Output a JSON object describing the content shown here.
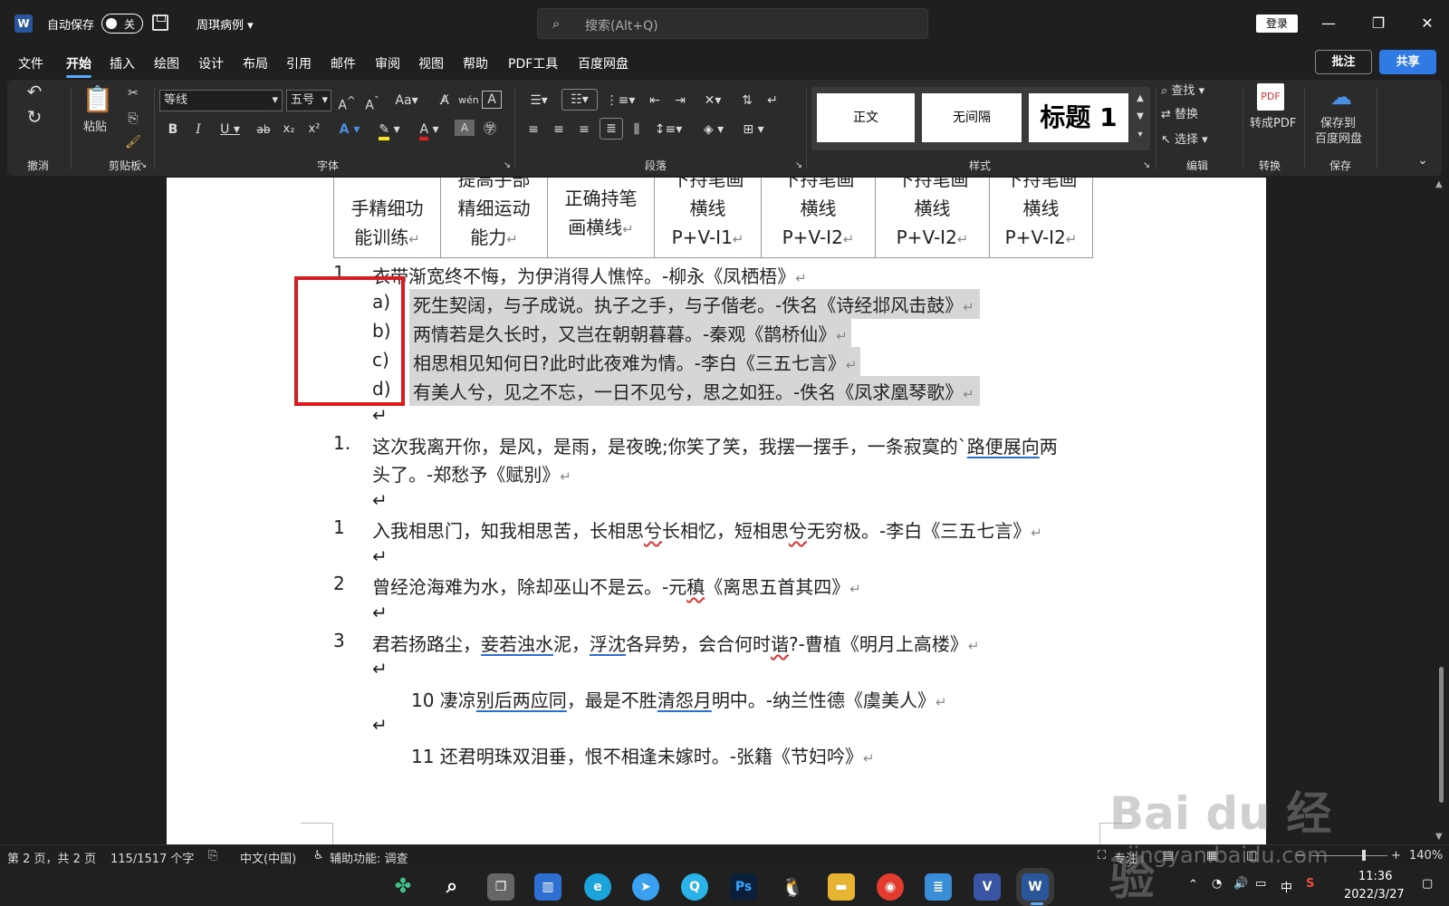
{
  "app": {
    "autosave_label": "自动保存",
    "autosave_state": "关",
    "doc_title": "周琪病例 ▾",
    "search_placeholder": "搜索(Alt+Q)",
    "login_label": "登录"
  },
  "tabs": [
    "文件",
    "开始",
    "插入",
    "绘图",
    "设计",
    "布局",
    "引用",
    "邮件",
    "审阅",
    "视图",
    "帮助",
    "PDF工具",
    "百度网盘"
  ],
  "active_tab": "开始",
  "tab_actions": {
    "comment": "批注",
    "share": "共享"
  },
  "ribbon": {
    "undo_group": "撤消",
    "clipboard": {
      "paste": "粘贴",
      "group": "剪贴板"
    },
    "font": {
      "name": "等线",
      "size": "五号",
      "group": "字体"
    },
    "paragraph_group": "段落",
    "styles": {
      "items": [
        "正文",
        "无间隔",
        "标题 1"
      ],
      "group": "样式"
    },
    "editing": {
      "find": "查找",
      "replace": "替换",
      "select": "选择",
      "group": "编辑"
    },
    "convert": {
      "label": "转成PDF",
      "group": "转换"
    },
    "save": {
      "label_line1": "保存到",
      "label_line2": "百度网盘",
      "group": "保存"
    }
  },
  "table_header": [
    [
      "手精细功",
      "能训练"
    ],
    [
      "提高手部",
      "精细运动",
      "能力"
    ],
    [
      "正确持笔",
      "画横线"
    ],
    [
      "下持笔画",
      "横线",
      "P+V-I1"
    ],
    [
      "下持笔画",
      "横线",
      "P+V-I2"
    ],
    [
      "下持笔画",
      "横线",
      "P+V-I2"
    ],
    [
      "下持笔画",
      "横线",
      "P+V-I2"
    ]
  ],
  "document": {
    "item1": {
      "num": "1.",
      "text": "衣带渐宽终不悔，为伊消得人憔悴。-柳永《凤栖梧》"
    },
    "sub_items": [
      {
        "label": "a)",
        "text": "死生契阔，与子成说。执子之手，与子偕老。-佚名《诗经邶风击鼓》"
      },
      {
        "label": "b)",
        "text": "两情若是久长时，又岂在朝朝暮暮。-秦观《鹊桥仙》"
      },
      {
        "label": "c)",
        "text": "相思相见知何日?此时此夜难为情。-李白《三五七言》"
      },
      {
        "label": "d)",
        "text": "有美人兮，见之不忘，一日不见兮，思之如狂。-佚名《凤求凰琴歌》"
      }
    ],
    "item2": {
      "num": "1.",
      "line1_a": "这次我离开你，是风，是雨，是夜晚;你笑了笑，我摆一摆手，一条寂寞的`",
      "line1_b": "路便展向",
      "line1_c": "两",
      "line2": "头了。-郑愁予《赋别》"
    },
    "item3": {
      "num": "1",
      "a": "入我相思门，知我相思苦，长相思",
      "b": "兮",
      "c": "长相忆，短相思",
      "d": "兮",
      "e": "无穷极。-李白《三五七言》"
    },
    "item4": {
      "num": "2",
      "a": "曾经沧海难为水，除却巫山不是云。-元",
      "b": "稹",
      "c": "《离思五首其四》"
    },
    "item5": {
      "num": "3",
      "a": "君若扬路尘，",
      "b": "妾若浊水",
      "c": "泥，",
      "d": "浮沈",
      "e": "各异势，会合何时",
      "f": "谐",
      "g": "?-曹植《明月上高楼》"
    },
    "item6": {
      "a": "10 凄凉",
      "b": "别后两应同",
      "c": "，最是不胜",
      "d": "清怨月",
      "e": "明中。-纳兰性德《虞美人》"
    },
    "item7": {
      "text": "11 还君明珠双泪垂，恨不相逢未嫁时。-张籍《节妇吟》"
    },
    "para_mark": "↵"
  },
  "status": {
    "page": "第 2 页，共 2 页",
    "words": "115/1517 个字",
    "language": "中文(中国)",
    "accessibility": "辅助功能: 调查",
    "focus": "专注",
    "zoom": "140%"
  },
  "taskbar": {
    "apps": [
      "start",
      "search",
      "task-view",
      "widgets",
      "edge",
      "feishu",
      "browser-q",
      "photoshop",
      "qq",
      "explorer",
      "chrome",
      "notepad",
      "visio",
      "word"
    ],
    "tray_ime": "中",
    "time": "11:36",
    "date": "2022/3/27"
  },
  "watermark": {
    "logo": "Bai du 经验",
    "site": "jingyan.baidu.com"
  }
}
